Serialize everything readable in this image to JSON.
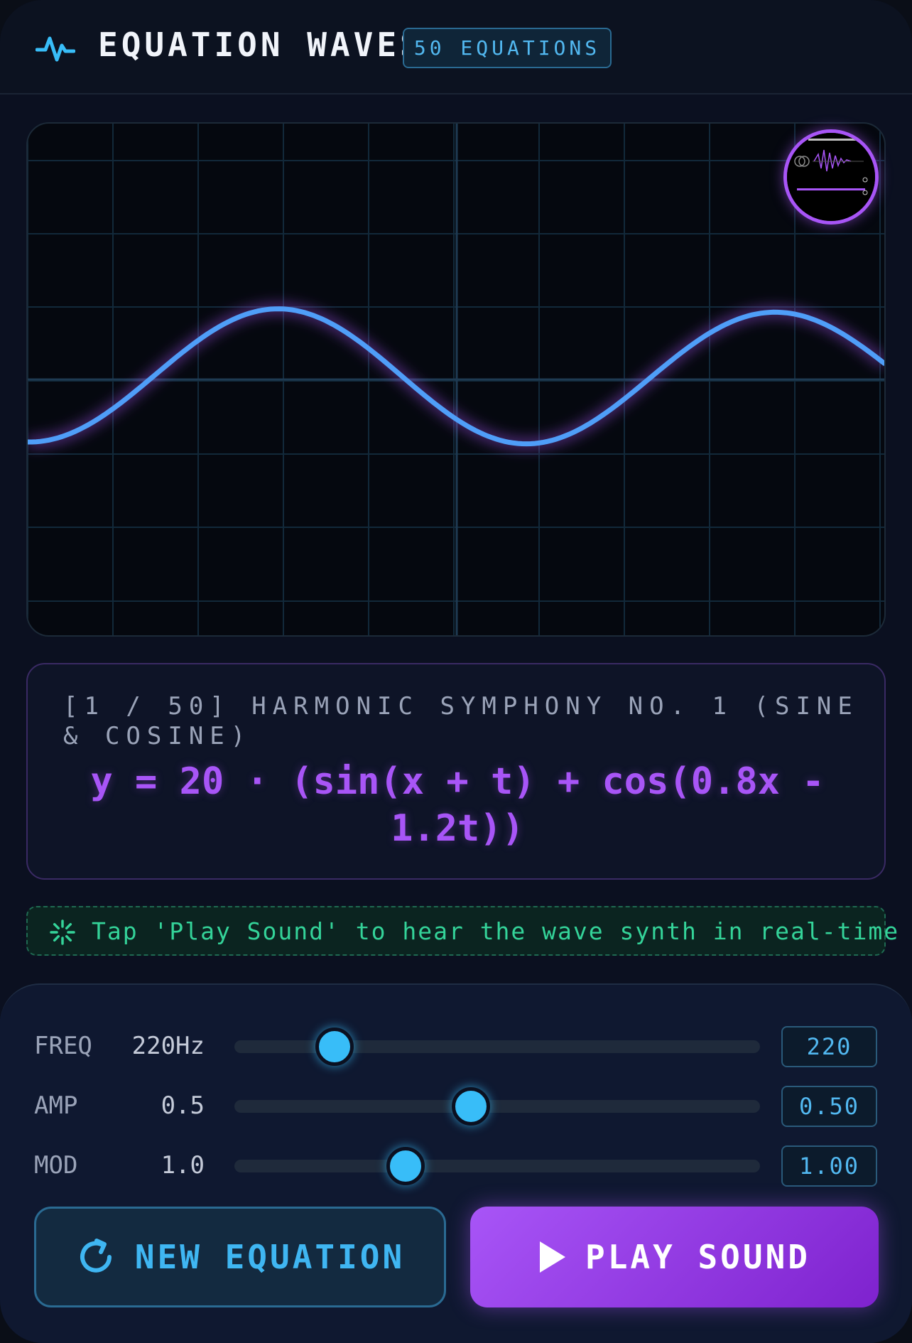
{
  "header": {
    "title": "EQUATION WAVES",
    "badge": "50 EQUATIONS",
    "logo_icon": "pulse-icon"
  },
  "plot": {
    "curve_color": "#4f9ef8",
    "glow_color": "#a855f7",
    "grid_color": "#12293a",
    "axis_color": "#1e3a52"
  },
  "equation": {
    "label": "[1 / 50] HARMONIC SYMPHONY NO. 1 (SINE & COSINE)",
    "formula": "y = 20 · (sin(x + t) + cos(0.8x - 1.2t))"
  },
  "hint": {
    "icon": "loading-spinner-icon",
    "text": "Tap 'Play Sound' to hear the wave synth in real-time"
  },
  "sliders": [
    {
      "name": "FREQ",
      "display": "220Hz",
      "value": "220",
      "fraction": 0.19
    },
    {
      "name": "AMP",
      "display": "0.5",
      "value": "0.50",
      "fraction": 0.45
    },
    {
      "name": "MOD",
      "display": "1.0",
      "value": "1.00",
      "fraction": 0.325
    }
  ],
  "buttons": {
    "new_equation": "NEW EQUATION",
    "new_equation_icon": "refresh-icon",
    "play_sound": "PLAY SOUND",
    "play_sound_icon": "play-icon"
  },
  "colors": {
    "accent_blue": "#38bdf8",
    "accent_purple": "#a855f7",
    "hint_green": "#34d399"
  }
}
